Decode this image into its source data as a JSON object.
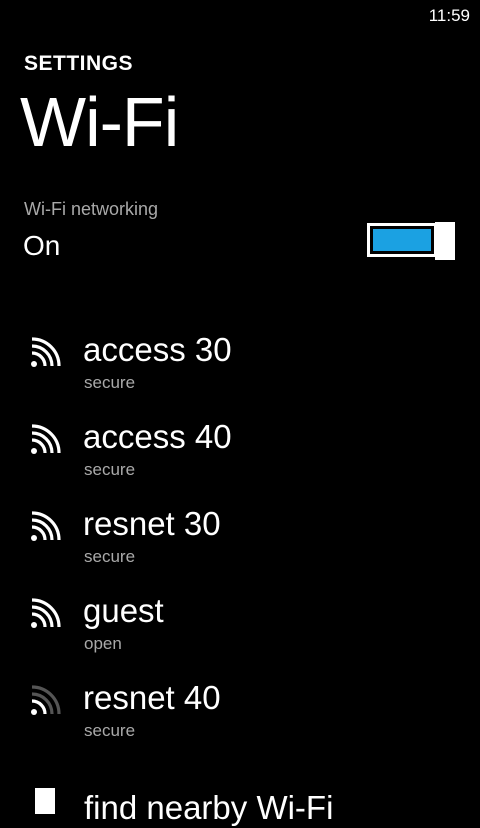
{
  "status_bar": {
    "time": "11:59"
  },
  "header": {
    "app_title": "SETTINGS",
    "page_title": "Wi-Fi"
  },
  "wifi_toggle": {
    "caption": "Wi-Fi networking",
    "state": "On",
    "on": true,
    "accent_color": "#1ba1e2"
  },
  "networks": [
    {
      "name": "access 30",
      "security": "secure",
      "icon": "wifi-signal-icon",
      "signal_bars": 4,
      "max_bars": 4
    },
    {
      "name": "access 40",
      "security": "secure",
      "icon": "wifi-signal-icon",
      "signal_bars": 4,
      "max_bars": 4
    },
    {
      "name": "resnet 30",
      "security": "secure",
      "icon": "wifi-signal-icon",
      "signal_bars": 4,
      "max_bars": 4
    },
    {
      "name": "guest",
      "security": "open",
      "icon": "wifi-signal-icon",
      "signal_bars": 4,
      "max_bars": 4
    },
    {
      "name": "resnet 40",
      "security": "secure",
      "icon": "wifi-signal-icon",
      "signal_bars": 2,
      "max_bars": 4
    }
  ],
  "bottom_item": {
    "label": "find nearby Wi-Fi",
    "icon": "search-icon"
  }
}
